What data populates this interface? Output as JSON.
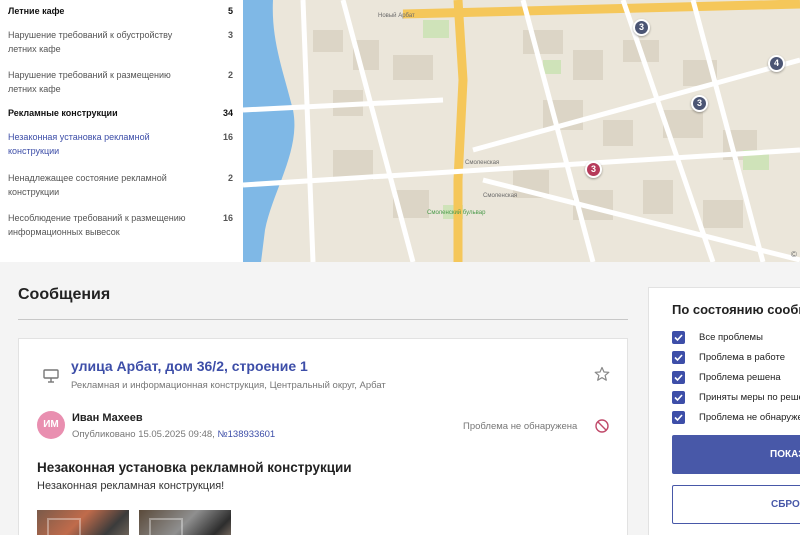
{
  "categories": [
    {
      "label": "Летние кафе",
      "count": "5",
      "kind": "head"
    },
    {
      "label": "Нарушение требований к обустройству летних кафе",
      "count": "3",
      "kind": "item"
    },
    {
      "label": "Нарушение требований к размещению летних кафе",
      "count": "2",
      "kind": "item"
    },
    {
      "label": "Рекламные конструкции",
      "count": "34",
      "kind": "head"
    },
    {
      "label": "Незаконная установка рекламной конструкции",
      "count": "16",
      "kind": "active"
    },
    {
      "label": "Ненадлежащее состояние рекламной конструкции",
      "count": "2",
      "kind": "item"
    },
    {
      "label": "Несоблюдение требований к размещению информационных вывесок",
      "count": "16",
      "kind": "item"
    }
  ],
  "map": {
    "labels": {
      "street_top": "Новый Арбат",
      "metro1": "Смоленская",
      "metro2": "Смоленская",
      "district": "Смоленский бульвар"
    },
    "pins": [
      {
        "value": "3",
        "style": "dark"
      },
      {
        "value": "4",
        "style": "dark"
      },
      {
        "value": "3",
        "style": "dark"
      },
      {
        "value": "3",
        "style": "red"
      }
    ],
    "copyright": "©"
  },
  "messages": {
    "title": "Сообщения",
    "card": {
      "address": "улица Арбат, дом 36/2, строение 1",
      "address_sub": "Рекламная и информационная конструкция, Центральный округ, Арбат",
      "avatar_initials": "ИМ",
      "author": "Иван Махеев",
      "published_prefix": "Опубликовано 15.05.2025 09:48,",
      "number": "№138933601",
      "status": "Проблема не обнаружена",
      "problem_title": "Незаконная установка рекламной конструкции",
      "problem_text": "Незаконная рекламная конструкция!"
    }
  },
  "filter": {
    "title": "По состоянию сообщения",
    "options": [
      {
        "label": "Все проблемы",
        "checked": true
      },
      {
        "label": "Проблема в работе",
        "checked": true
      },
      {
        "label": "Проблема решена",
        "checked": true
      },
      {
        "label": "Приняты меры по решению",
        "checked": true
      },
      {
        "label": "Проблема не обнаружена",
        "checked": true
      }
    ],
    "apply_label": "ПОКАЗАТЬ",
    "reset_label": "СБРОСИТЬ"
  },
  "colors": {
    "accent": "#3d4ea8",
    "pin_dark": "#4b5574",
    "pin_red": "#b63a5a",
    "avatar": "#e98fb0",
    "water": "#7fb8e6",
    "road_major": "#f5c75a"
  }
}
